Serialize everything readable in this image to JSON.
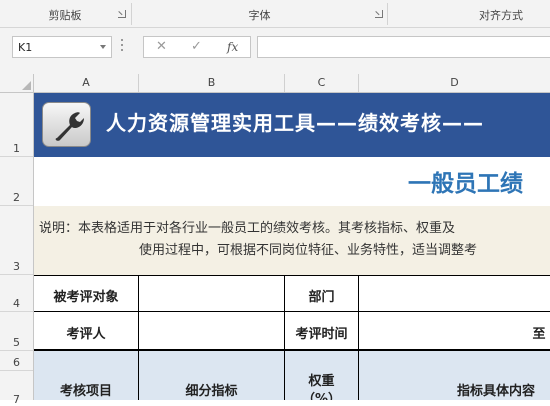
{
  "ribbon": {
    "groups": [
      {
        "label": "剪贴板"
      },
      {
        "label": "字体"
      },
      {
        "label": "对齐方式"
      }
    ]
  },
  "formula_bar": {
    "name_box": "K1",
    "cancel_icon": "✕",
    "enter_icon": "✓",
    "fx_label": "fx",
    "formula": ""
  },
  "columns": [
    "A",
    "B",
    "C",
    "D"
  ],
  "rows": [
    "1",
    "2",
    "3",
    "4",
    "5",
    "6",
    "7"
  ],
  "sheet": {
    "banner_title": "人力资源管理实用工具——绩效考核——",
    "subtitle": "一般员工绩",
    "description_line1": "说明：本表格适用于对各行业一般员工的绩效考核。其考核指标、权重及",
    "description_line2": "使用过程中，可根据不同岗位特征、业务特性，适当调整考",
    "label_subject": "被考评对象",
    "label_dept": "部门",
    "label_reviewer": "考评人",
    "label_time": "考评时间",
    "value_time_to": "至",
    "header_item": "考核项目",
    "header_sub": "细分指标",
    "header_weight_1": "权重",
    "header_weight_2": "（%）",
    "header_detail": "指标具体内容"
  },
  "colors": {
    "banner_bg": "#2f5597",
    "subtitle_text": "#2e75b6",
    "description_bg": "#f4f0e4",
    "header_bg": "#dce6f1"
  }
}
